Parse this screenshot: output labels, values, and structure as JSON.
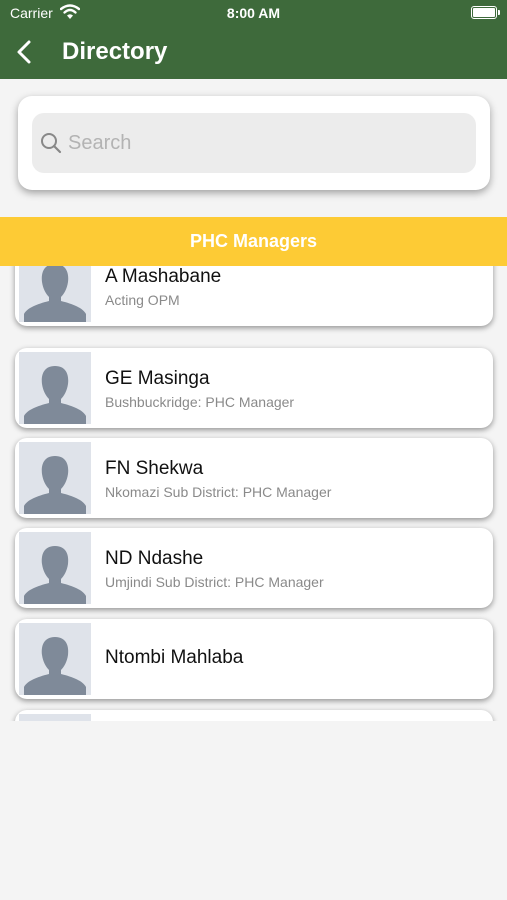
{
  "status_bar": {
    "carrier": "Carrier",
    "time": "8:00 AM"
  },
  "nav": {
    "title": "Directory"
  },
  "search": {
    "placeholder": "Search"
  },
  "section": {
    "title": "PHC Managers"
  },
  "contacts": [
    {
      "name": "A Mashabane",
      "subtitle": "Acting OPM"
    },
    {
      "name": "GE Masinga",
      "subtitle": "Bushbuckridge: PHC Manager"
    },
    {
      "name": "FN Shekwa",
      "subtitle": "Nkomazi Sub District: PHC Manager"
    },
    {
      "name": "ND Ndashe",
      "subtitle": "Umjindi Sub District: PHC Manager"
    },
    {
      "name": "Ntombi Mahlaba",
      "subtitle": ""
    },
    {
      "name": "",
      "subtitle": ""
    }
  ],
  "colors": {
    "header": "#3e6a3b",
    "section": "#fdcb35",
    "background": "#f4f4f4"
  }
}
